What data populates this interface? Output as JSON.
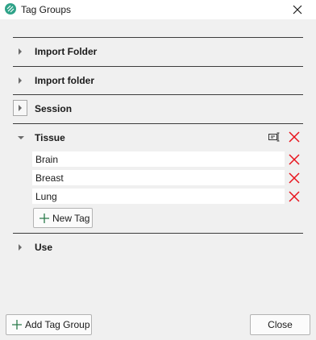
{
  "window": {
    "title": "Tag Groups"
  },
  "groups": [
    {
      "label": "Import Folder"
    },
    {
      "label": "Import folder"
    },
    {
      "label": "Session"
    },
    {
      "label": "Tissue",
      "tags": [
        "Brain",
        "Breast",
        "Lung"
      ],
      "new_tag_label": "New Tag"
    },
    {
      "label": "Use"
    }
  ],
  "footer": {
    "add_group_label": "Add Tag Group",
    "close_label": "Close"
  },
  "colors": {
    "delete": "#e8131c",
    "accent": "#2fa389",
    "divider": "#3c3c3c"
  },
  "icons": {
    "app": "app-logo-icon",
    "close": "close-icon",
    "rename": "rename-icon",
    "delete": "delete-icon",
    "add": "plus-icon"
  }
}
